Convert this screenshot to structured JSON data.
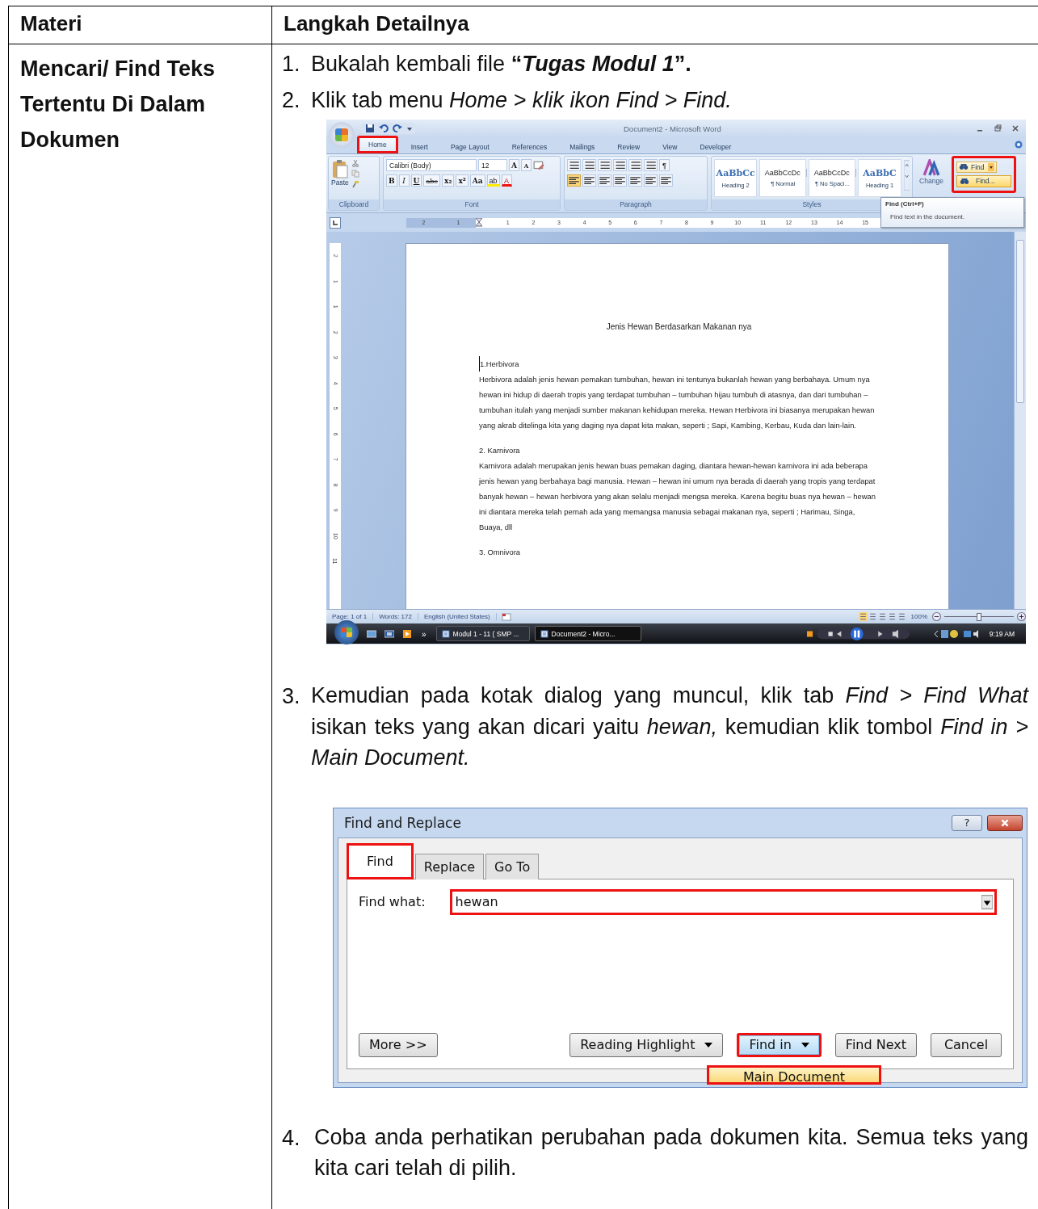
{
  "table": {
    "columns": [
      "Materi",
      "Langkah Detailnya"
    ],
    "rows": [
      {
        "topic": "Mencari/ Find Teks Tertentu Di Dalam Dokumen",
        "steps": [
          {
            "number": "1.",
            "text": "Bukalah kembali file **“*Tugas Modul 1*”.**"
          },
          {
            "number": "2.",
            "text": "Klik tab menu *Home > klik ikon Find > Find.*"
          },
          {
            "number": "3.",
            "text": "Kemudian pada kotak dialog yang muncul, klik tab *Find > Find What* isikan teks yang akan dicari yaitu *hewan,* kemudian klik tombol *Find in > Main Document.*"
          },
          {
            "number": "4.",
            "text": "Coba anda perhatikan perubahan pada dokumen kita. Semua teks yang kita cari telah di pilih."
          }
        ]
      }
    ]
  },
  "word_window": {
    "title": "Document2 - Microsoft Word",
    "tabs": [
      {
        "label": "Home",
        "selected": true,
        "highlighted": true
      },
      {
        "label": "Insert",
        "selected": false,
        "highlighted": false
      },
      {
        "label": "Page Layout",
        "selected": false,
        "highlighted": false
      },
      {
        "label": "References",
        "selected": false,
        "highlighted": false
      },
      {
        "label": "Mailings",
        "selected": false,
        "highlighted": false
      },
      {
        "label": "Review",
        "selected": false,
        "highlighted": false
      },
      {
        "label": "View",
        "selected": false,
        "highlighted": false
      },
      {
        "label": "Developer",
        "selected": false,
        "highlighted": false
      }
    ],
    "clipboard": {
      "label": "Clipboard",
      "paste": "Paste"
    },
    "font": {
      "label": "Font",
      "name": "Calibri (Body)",
      "size": "12",
      "size_buttons": [
        "A",
        "A"
      ],
      "buttons": [
        "B",
        "I",
        "U",
        "abe",
        "x₂",
        "x²",
        "Aa"
      ],
      "highlight_button": "ab",
      "color_button": "A"
    },
    "paragraph": {
      "label": "Paragraph",
      "pilcrow": "¶"
    },
    "styles": {
      "label": "Styles",
      "items": [
        {
          "sample": "AaBbCc",
          "name": "Heading 2",
          "kind": "heading"
        },
        {
          "sample": "AaBbCcDc",
          "name": "¶ Normal",
          "kind": "body"
        },
        {
          "sample": "AaBbCcDc",
          "name": "¶ No Spaci...",
          "kind": "body"
        },
        {
          "sample": "AaBbC",
          "name": "Heading 1",
          "kind": "heading"
        }
      ],
      "change_styles": "Change"
    },
    "editing": {
      "highlighted": true,
      "find_button": "Find",
      "menu_item": "Find..."
    },
    "tooltip": {
      "title": "Find (Ctrl+F)",
      "text": "Find text in the document."
    },
    "ruler": {
      "left_numbers": [
        "2",
        "1"
      ],
      "numbers": [
        "1",
        "2",
        "3",
        "4",
        "5",
        "6",
        "7",
        "8",
        "9",
        "10",
        "11",
        "12",
        "13",
        "14",
        "15"
      ],
      "vertical_numbers": [
        "2",
        "1",
        "1",
        "2",
        "3",
        "4",
        "5",
        "6",
        "7",
        "8",
        "9",
        "10",
        "11"
      ]
    },
    "document": {
      "title": "Jenis Hewan Berdasarkan Makanan nya",
      "sections": [
        {
          "heading": "1.Herbivora",
          "body": "Herbivora adalah jenis hewan pemakan tumbuhan,  hewan ini tentunya bukanlah hewan yang berbahaya. Umum nya hewan ini hidup di daerah tropis yang terdapat tumbuhan – tumbuhan hijau tumbuh  di atasnya, dan dari tumbuhan  – tumbuhan  itulah yang menjadi sumber makanan kehidupan  mereka. Hewan Herbivora ini biasanya merupakan hewan yang akrab ditelinga kita yang daging nya dapat kita makan, seperti  ; Sapi, Kambing, Kerbau, Kuda dan lain-lain."
        },
        {
          "heading": "2. Karnivora",
          "body": "Karnivora adalah merupakan jenis hewan buas pemakan daging, diantara hewan-hewan karnivora ini ada beberapa jenis hewan yang berbahaya bagi manusia. Hewan – hewan ini umum nya berada di daerah yang tropis yang terdapat banyak hewan – hewan herbivora yang akan selalu menjadi mengsa mereka. Karena begitu buas nya hewan  – hewan ini diantara mereka telah pernah ada yang memangsa manusia sebagai makanan nya, seperti ; Harimau, Singa, Buaya, dll"
        },
        {
          "heading": "3. Omnivora"
        }
      ]
    },
    "status_bar": {
      "page": "Page: 1 of 1",
      "words": "Words: 172",
      "language": "English (United States)",
      "zoom": "100%",
      "zoom_slider": {
        "level": 0.5
      }
    },
    "taskbar": {
      "more": "»",
      "tasks": [
        {
          "label": "Modul 1 - 11 ( SMP ...",
          "selected": false
        },
        {
          "label": "Document2 - Micro...",
          "selected": true
        }
      ],
      "clock": "9:19 AM"
    }
  },
  "find_dialog": {
    "title": "Find and Replace",
    "help": "?",
    "tabs": [
      {
        "label": "Find",
        "selected": true,
        "highlighted": true
      },
      {
        "label": "Replace",
        "selected": false,
        "highlighted": false
      },
      {
        "label": "Go To",
        "selected": false,
        "highlighted": false
      }
    ],
    "find_what": {
      "label": "Find what:",
      "value": "hewan",
      "highlighted": true
    },
    "buttons": [
      {
        "label": "More >>",
        "kind": "plain",
        "selected": false,
        "highlighted": false
      },
      {
        "label": "Reading Highlight",
        "kind": "dropdown",
        "selected": false,
        "highlighted": false
      },
      {
        "label": "Find in",
        "kind": "dropdown",
        "selected": true,
        "highlighted": true
      },
      {
        "label": "Find Next",
        "kind": "plain",
        "selected": false,
        "highlighted": false
      },
      {
        "label": "Cancel",
        "kind": "plain",
        "selected": false,
        "highlighted": false
      }
    ],
    "menu": {
      "item": "Main Document",
      "highlighted": true
    }
  }
}
